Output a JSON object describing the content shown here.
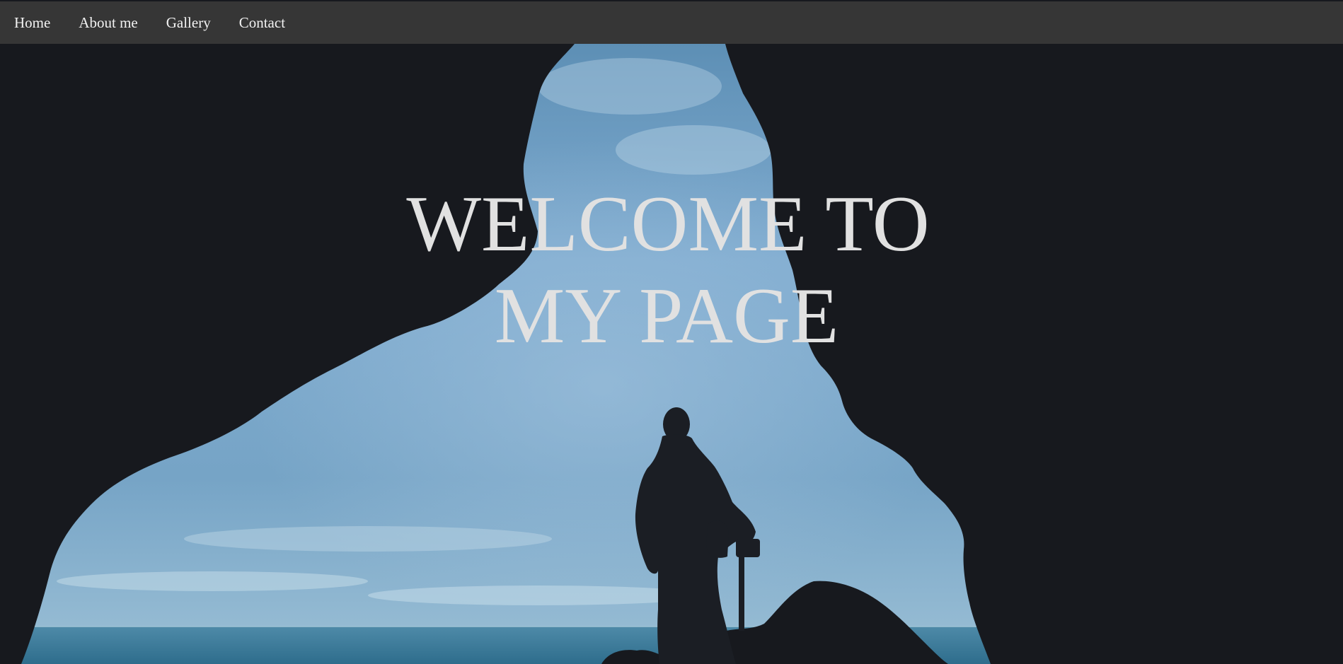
{
  "nav": {
    "items": [
      {
        "label": "Home"
      },
      {
        "label": "About me"
      },
      {
        "label": "Gallery"
      },
      {
        "label": "Contact"
      }
    ]
  },
  "hero": {
    "title_line1": "WELCOME TO",
    "title_line2": "MY PAGE",
    "background_image": "cave-silhouette-photo"
  },
  "colors": {
    "navbar": "#363636",
    "nav_text": "#f2f2f2",
    "title_text": "#e1e1e1",
    "rock": "#17191e",
    "sky": "#7aa6c6",
    "sea": "#3f7f9e"
  }
}
